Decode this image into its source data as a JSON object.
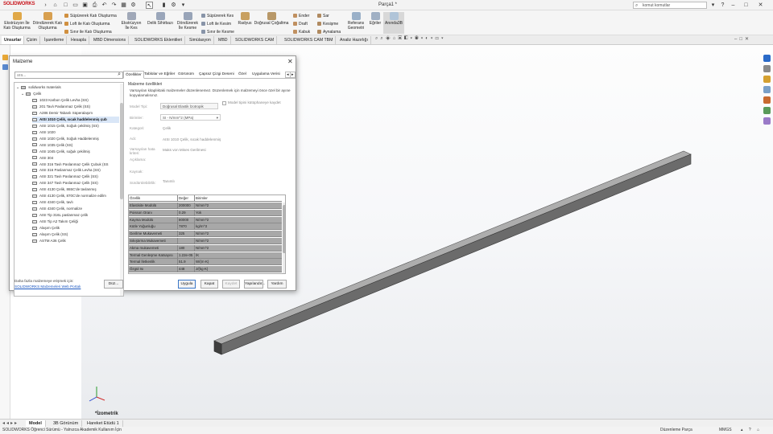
{
  "app": {
    "logo_text": "SOLIDWORKS",
    "doc_title": "Parça1 *",
    "search_placeholder": "komut komutlar"
  },
  "ribbon": {
    "big_buttons": [
      {
        "label": "Ekstrüzyon İle Katı Oluşturma"
      },
      {
        "label": "Döndürerek Katı Oluşturma"
      },
      {
        "label": "Ekstrüzyon İle Kes"
      },
      {
        "label": "Delik Sihirbazı"
      },
      {
        "label": "Döndürerek İle Kesme"
      },
      {
        "label": "Radyus"
      },
      {
        "label": "Doğrusal Çoğaltma"
      },
      {
        "label": "Referans Geometri"
      },
      {
        "label": "Eğriler"
      },
      {
        "label": "Anında3B"
      }
    ],
    "small_buttons": [
      "Süpürerek Katı Oluşturma",
      "Loft ile Katı Oluşturma",
      "Sınır ile Katı Oluşturma",
      "Süpürerek Kes",
      "Loft ile Kesim",
      "Sınır ile Kesme",
      "Ender",
      "Draft",
      "Kabuk",
      "Sar",
      "Kesişme",
      "Aynalama"
    ]
  },
  "command_tabs": [
    "Unsurlar",
    "Çizim",
    "İşaretleme",
    "Hesapla",
    "MBD Dimensions",
    "SOLIDWORKS Eklentileri",
    "Simülasyon",
    "MBD",
    "SOLIDWORKS CAM",
    "SOLIDWORKS CAM TBM",
    "Analiz Hazırlığı"
  ],
  "dialog": {
    "title": "Malzeme",
    "search_placeholder": "ara...",
    "tree": {
      "root": "solidworks materials",
      "group": "Çelik",
      "items": [
        "1023 Karbon Çelik Levha (SS)",
        "201 Tavlı Paslanmaz Çelik (SS)",
        "A286 Demir Tabanlı Süperalaşım",
        "AISI 1010 Çelik, sıcak haddelenmiş çub",
        "AISI 1015 Çelik, Soğuk çekilmiş (SS)",
        "AISI 1020",
        "AISI 1020 Çelik, Soğuk Haddelenmiş",
        "AISI 1035 Çelik (SS)",
        "AISI 1045 Çelik, soğuk çekilmiş",
        "AISI 304",
        "AISI 316 Tavlı Paslanmaz Çelik Çubuk (SS",
        "AISI 316 Paslanmaz Çelik Levha (SS)",
        "AISI 321 Tavlı Paslanmaz Çelik (SS)",
        "AISI 347 Tavlı Paslanmaz Çelik (SS)",
        "AISI 4130 Çelik, 865C'de tavlanmış",
        "AISI 4130 Çelik, 870C'de normalize edilm",
        "AISI 4340 Çelik, tavlı",
        "AISI 4340 Çelik, normalize",
        "AISI Tip 316L paslanmaz çelik",
        "AISI Tip A2 Takım Çeliği",
        "Alaşım Çelik",
        "Alaşım Çelik (SS)",
        "ASTM A36 Çelik"
      ],
      "selected_index": 3
    },
    "tabs": [
      "Özellikler",
      "Tablolar ve Eğriler",
      "Görünüm",
      "Çapraz Çizgi Deseni",
      "Özel",
      "Uygulama Verisi"
    ],
    "properties_heading": "Malzeme özellikleri",
    "properties_note": "Varsayılan kitaplıktaki malzemeler düzenlenemez. Düzenlemek için malzemeyi önce özel bir ayıne kopyalamalısınız.",
    "model_type_label": "Model Tipi:",
    "model_type_value": "Doğrusal Elastik İzotropik",
    "save_library_label": "Model tipini kütüphaneye kaydet",
    "units_label": "Birimler:",
    "units_value": "SI - N/mm^2 (MPa)",
    "category_label": "Kategori:",
    "category_value": "Çelik",
    "name_label": "Adı:",
    "name_value": "AISI 1010 Çelik, sıcak haddelenmiş",
    "failure_label": "Varsayılan hata kriteri:",
    "failure_value": "Maks von Mises Gerilmesi",
    "desc_label": "Açıklama:",
    "source_label": "Kaynak:",
    "sustainability_label": "Sürdürülebilirlik:",
    "sustainability_value": "Tanımlı",
    "table_headers": [
      "Özellik",
      "Değer",
      "Birimler"
    ],
    "table_rows": [
      [
        "Elastisite Modülü",
        "200000",
        "N/mm^2"
      ],
      [
        "Poisson Oranı",
        "0.29",
        "Yok"
      ],
      [
        "Kayma Modülü",
        "80000",
        "N/mm^2"
      ],
      [
        "Kütle Yoğunluğu",
        "7870",
        "kg/m^3"
      ],
      [
        "Gerilme Mukavemeti",
        "325",
        "N/mm^2"
      ],
      [
        "Sıkıştırma Mukavemeti",
        "",
        "N/mm^2"
      ],
      [
        "Akma mukavemeti",
        "180",
        "N/mm^2"
      ],
      [
        "Termal Genleşme Katsayısı",
        "1.22e-05",
        "/K"
      ],
      [
        "Termal İletkenlik",
        "51.9",
        "W/(m·K)"
      ],
      [
        "Özgül Isı",
        "448",
        "J/(kg·K)"
      ]
    ],
    "footer_text": "Daha fazla malzemeye erişmek için:",
    "footer_link": "SOLIDWORKS Malzemeleri Web Portalı",
    "buttons": {
      "edit": "Düz...",
      "apply": "Uygula",
      "close": "Kapat",
      "save": "Kaydet",
      "config": "Yapılandır...",
      "help": "Yardım"
    }
  },
  "viewport": {
    "view_label": "*İzometrik"
  },
  "bottom_tabs": [
    "Model",
    "3B Görünüm",
    "Hareket Etüdü 1"
  ],
  "status": {
    "left": "SOLIDWORKS Öğrenci Sürümü - Yalnızca Akademik Kullanım İçin",
    "mid": "Düzenleme Parça",
    "units": "MMGS"
  },
  "colors": {
    "brand": "#c8161d",
    "selection": "#d9e6f7",
    "table_body": "#a8a8a8",
    "beam_top": "#adadad",
    "beam_front": "#6b6b6b",
    "beam_side": "#3e3e3e"
  }
}
